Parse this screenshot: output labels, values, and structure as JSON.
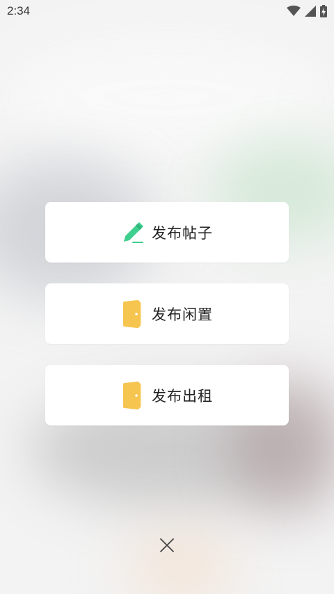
{
  "status_bar": {
    "time": "2:34"
  },
  "menu": {
    "items": [
      {
        "label": "发布帖子",
        "icon": "pencil-icon",
        "icon_color": "#3ecf8e"
      },
      {
        "label": "发布闲置",
        "icon": "door-icon",
        "icon_color": "#f6c550"
      },
      {
        "label": "发布出租",
        "icon": "door-icon",
        "icon_color": "#f6c550"
      }
    ]
  },
  "close": {
    "icon": "close-icon"
  }
}
